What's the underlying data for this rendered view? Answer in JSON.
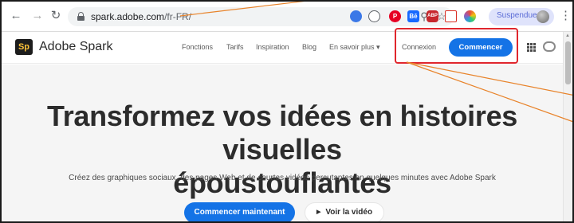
{
  "browser": {
    "back_glyph": "←",
    "forward_glyph": "→",
    "reload_glyph": "↻",
    "url_host": "spark.adobe.com",
    "url_path": "/fr-FR/",
    "zoom_glyph": "⚲",
    "star_glyph": "☆",
    "profile_label": "Suspendue",
    "menu_glyph": "⋮"
  },
  "extensions": [
    {
      "name": "circle-blue",
      "color": "#3b78e7",
      "glyph": ""
    },
    {
      "name": "gauge",
      "color": "#5f6368",
      "glyph": ""
    },
    {
      "name": "pinterest",
      "color": "#e60023",
      "glyph": "P"
    },
    {
      "name": "behance",
      "color": "#1769ff",
      "glyph": "Bē"
    },
    {
      "name": "abp",
      "color": "#c7272c",
      "glyph": "ABP"
    },
    {
      "name": "ext-red",
      "color": "#d93025",
      "glyph": ""
    },
    {
      "name": "ext-multicolor",
      "color": "#8e44ad",
      "glyph": ""
    }
  ],
  "site": {
    "logo_text": "Sp",
    "brand_name": "Adobe Spark",
    "nav": [
      {
        "label": "Fonctions"
      },
      {
        "label": "Tarifs"
      },
      {
        "label": "Inspiration"
      },
      {
        "label": "Blog"
      },
      {
        "label": "En savoir plus ▾"
      }
    ],
    "login_label": "Connexion",
    "cta_label": "Commencer"
  },
  "hero": {
    "title_line1": "Transformez vos idées en histoires visuelles",
    "title_line2": "époustouflantes",
    "subtitle": "Créez des graphiques sociaux, des pages Web et de courtes vidéos percutantes en quelques minutes avec Adobe Spark",
    "primary_cta": "Commencer maintenant",
    "secondary_cta": "Voir la vidéo"
  },
  "colors": {
    "accent": "#1473e6",
    "annotation_box": "#e0262d",
    "annotation_lines": "#e8832a"
  }
}
